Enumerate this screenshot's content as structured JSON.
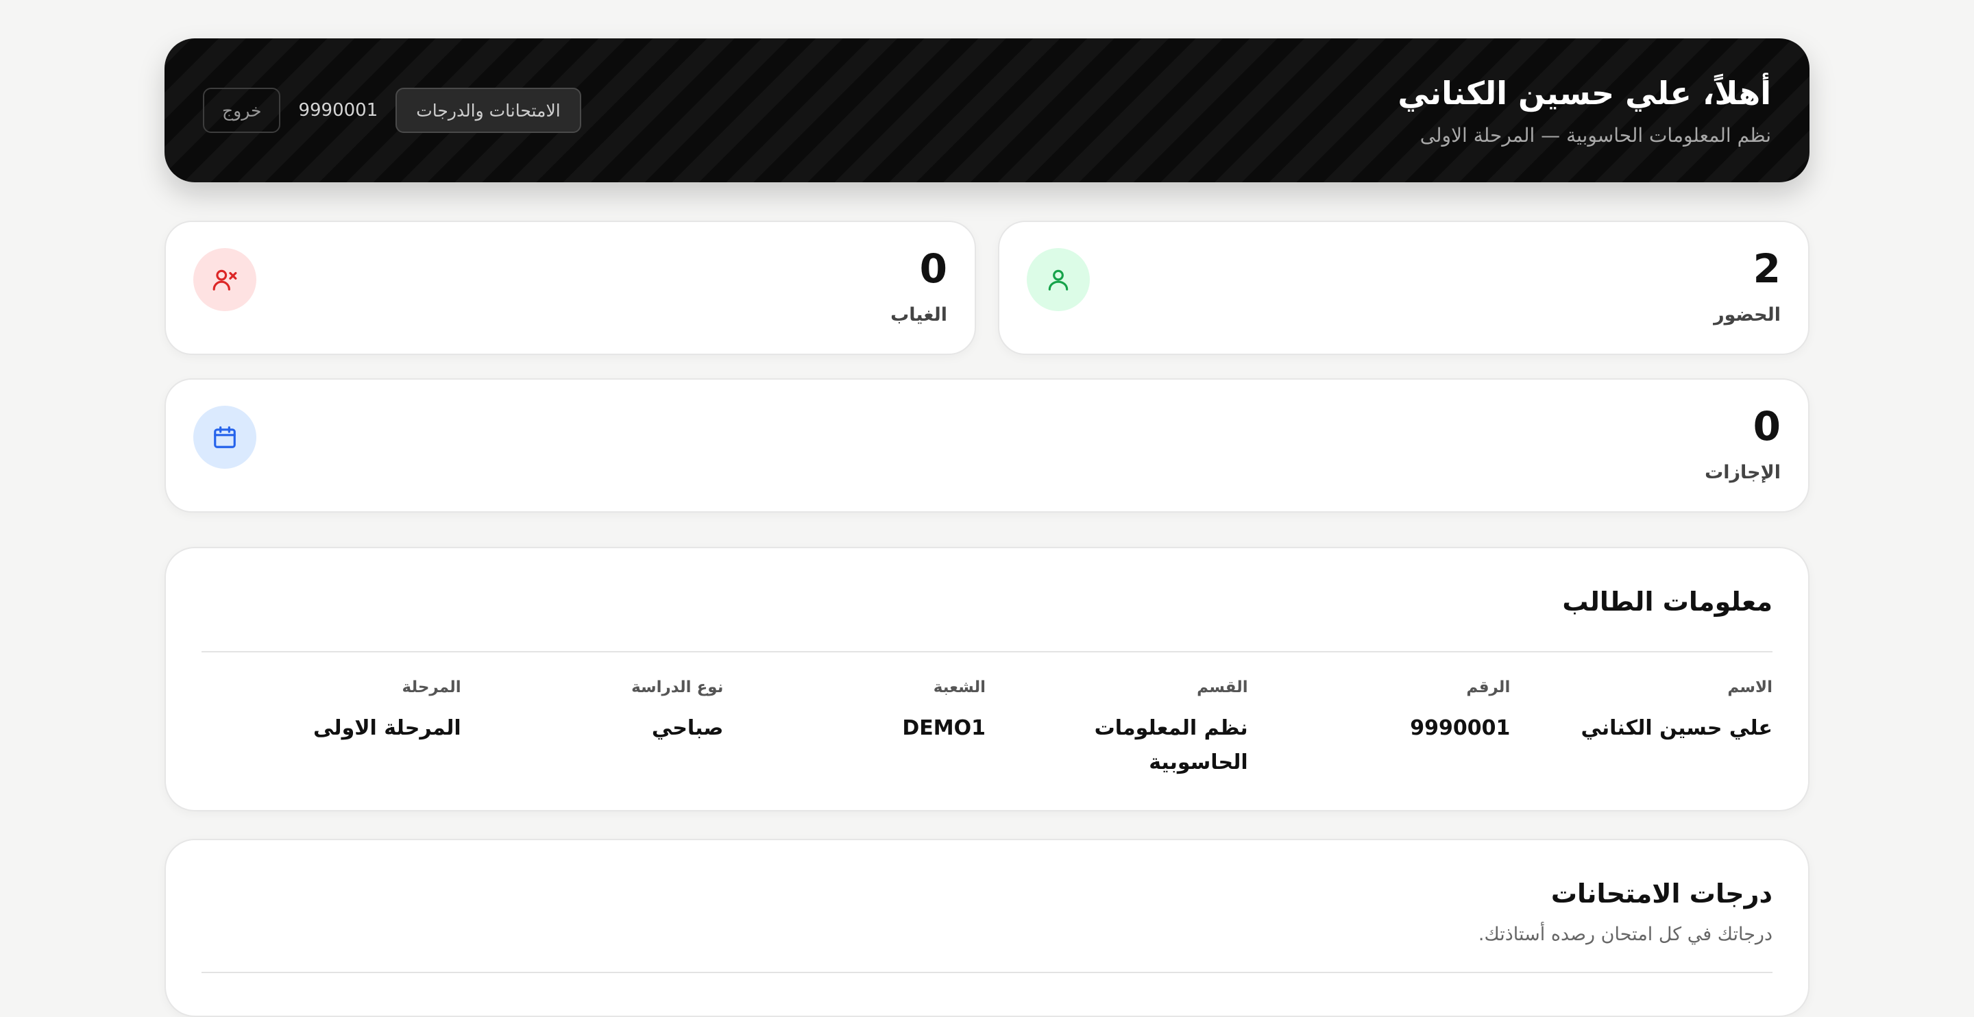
{
  "header": {
    "title": "أهلاً، علي حسين الكناني",
    "subtitle": "نظم المعلومات الحاسوبية — المرحلة الاولى",
    "exams_button": "الامتحانات والدرجات",
    "student_id": "9990001",
    "logout_button": "خروج"
  },
  "stats": {
    "attendance": {
      "value": "2",
      "label": "الحضور",
      "icon": "user-check-icon",
      "color": "#16a34a",
      "bg": "#dcfce7"
    },
    "absence": {
      "value": "0",
      "label": "الغياب",
      "icon": "user-x-icon",
      "color": "#dc2626",
      "bg": "#fee2e2"
    },
    "leaves": {
      "value": "0",
      "label": "الإجازات",
      "icon": "calendar-icon",
      "color": "#2563eb",
      "bg": "#dbeafe"
    }
  },
  "student_info": {
    "title": "معلومات الطالب",
    "fields": [
      {
        "label": "الاسم",
        "value": "علي حسين الكناني"
      },
      {
        "label": "الرقم",
        "value": "9990001"
      },
      {
        "label": "القسم",
        "value": "نظم المعلومات الحاسوبية"
      },
      {
        "label": "الشعبة",
        "value": "DEMO1"
      },
      {
        "label": "نوع الدراسة",
        "value": "صباحي"
      },
      {
        "label": "المرحلة",
        "value": "المرحلة الاولى"
      }
    ]
  },
  "exam_grades": {
    "title": "درجات الامتحانات",
    "subtitle": "درجاتك في كل امتحان رصده أستاذتك."
  }
}
